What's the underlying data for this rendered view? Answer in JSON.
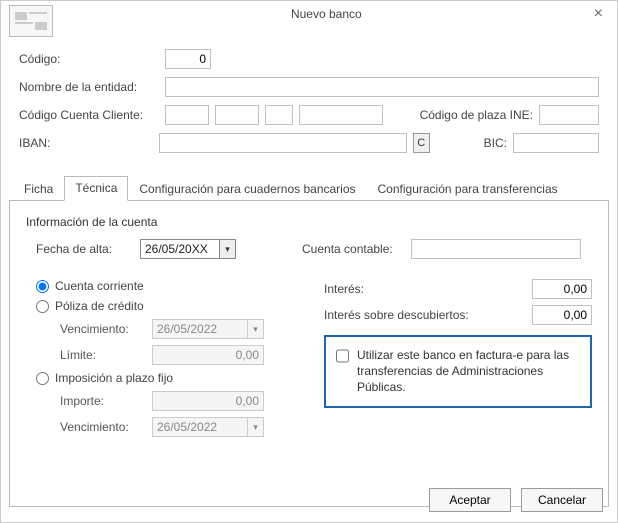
{
  "window": {
    "title": "Nuevo banco"
  },
  "toplabels": {
    "codigo": "Código:",
    "nombre": "Nombre de la entidad:",
    "ccc": "Código Cuenta Cliente:",
    "plaza": "Código de plaza INE:",
    "iban": "IBAN:",
    "bic": "BIC:",
    "ibanC": "C"
  },
  "topvalues": {
    "codigo": "0",
    "nombre": "",
    "ccc1": "",
    "ccc2": "",
    "ccc3": "",
    "ccc4": "",
    "plaza": "",
    "iban": "",
    "bic": ""
  },
  "tabs": {
    "ficha": "Ficha",
    "tecnica": "Técnica",
    "cuadernos": "Configuración para cuadernos bancarios",
    "transfer": "Configuración para transferencias"
  },
  "panel": {
    "groupTitle": "Información de la cuenta",
    "fechaAltaLbl": "Fecha de alta:",
    "fechaAltaVal": "26/05/20XX",
    "cuentaContLbl": "Cuenta contable:",
    "cuentaContVal": "",
    "radCorriente": "Cuenta corriente",
    "radPoliza": "Póliza de crédito",
    "polVencLbl": "Vencimiento:",
    "polVencVal": "26/05/2022",
    "polLimLbl": "Límite:",
    "polLimVal": "0,00",
    "radPlazo": "Imposición a plazo fijo",
    "plaImpLbl": "Importe:",
    "plaImpVal": "0,00",
    "plaVencLbl": "Vencimiento:",
    "plaVencVal": "26/05/2022",
    "interesLbl": "Interés:",
    "interesVal": "0,00",
    "interesDescLbl": "Interés sobre descubiertos:",
    "interesDescVal": "0,00",
    "highlightTxt": "Utilizar este banco en factura-e para las transferencias de Administraciones Públicas."
  },
  "footer": {
    "ok": "Aceptar",
    "cancel": "Cancelar"
  }
}
